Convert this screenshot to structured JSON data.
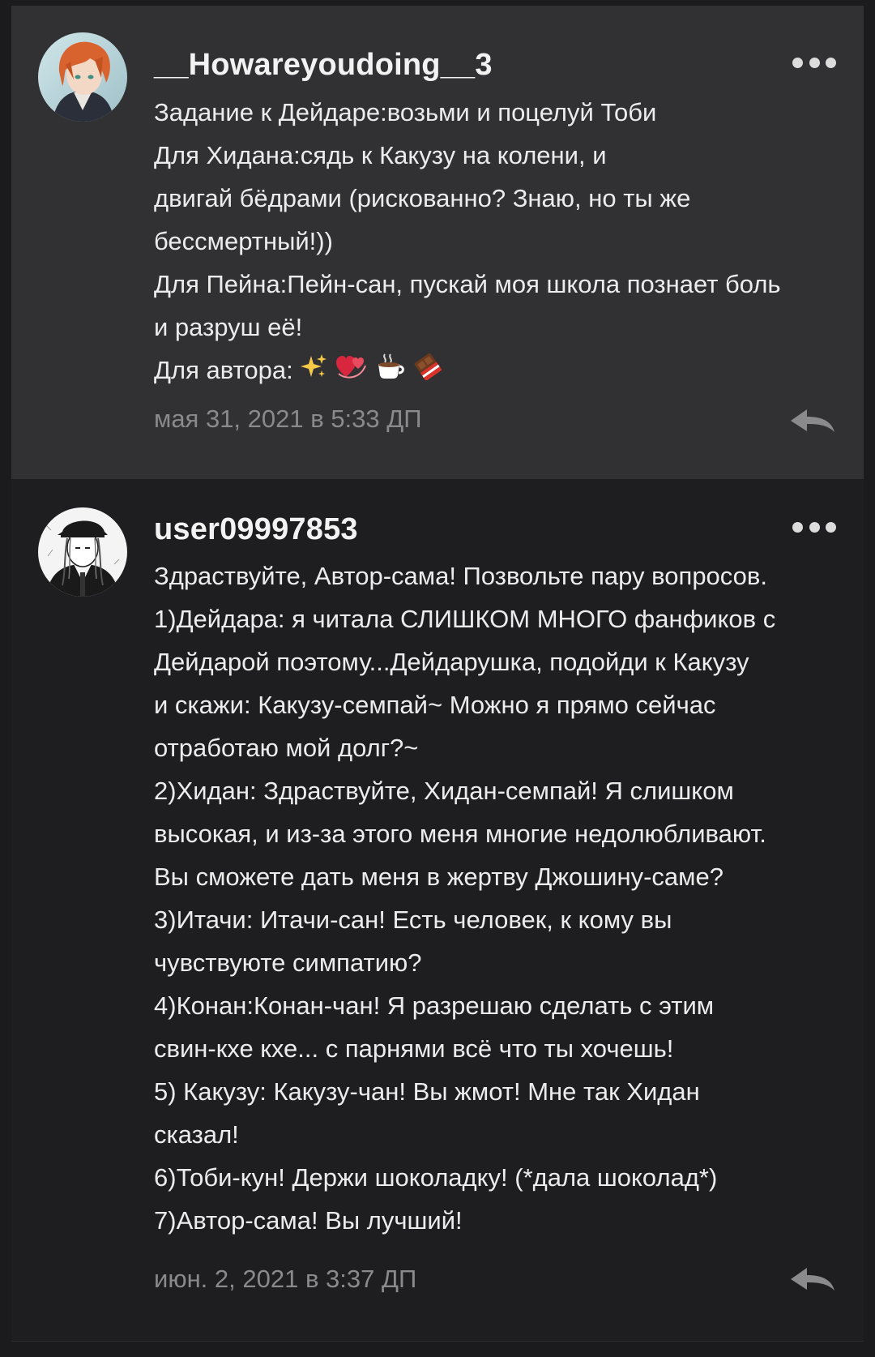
{
  "comments": [
    {
      "username": "__Howareyoudoing__3",
      "lines": [
        "Задание к Дейдаре:возьми и поцелуй Тоби",
        "Для Хидана:сядь к Какузу на колени, и",
        "двигай бёдрами (рискованно? Знаю, но ты же",
        "бессмертный!))",
        "Для Пейна:Пейн-сан, пускай моя школа познает боль",
        "и разруш её!"
      ],
      "last_line_text": "Для автора:",
      "last_line_emojis": [
        "sparkles-emoji",
        "revolving-hearts-emoji",
        "hot-beverage-emoji",
        "chocolate-bar-emoji"
      ],
      "timestamp": "мая 31, 2021 в 5:33 ДП"
    },
    {
      "username": "user09997853",
      "lines": [
        "Здраствуйте, Автор-сама! Позвольте пару вопросов.",
        "1)Дейдара: я читала СЛИШКОМ МНОГО фанфиков с",
        "Дейдарой поэтому...Дейдарушка, подойди к Какузу",
        "и скажи: Какузу-семпай~ Можно я прямо сейчас",
        "отработаю мой долг?~",
        "2)Хидан: Здраствуйте, Хидан-семпай! Я слишком",
        "высокая, и из-за этого меня многие недолюбливают.",
        "Вы сможете дать меня в жертву Джошину-саме?",
        "3)Итачи: Итачи-сан! Есть человек, к кому вы",
        "чувствуюте симпатию?",
        "4)Конан:Конан-чан! Я разрешаю сделать с этим",
        "свин-кхе кхе... с парнями всё что ты хочешь!",
        "5) Какузу: Какузу-чан! Вы жмот! Мне так Хидан",
        "сказал!",
        "6)Тоби-кун! Держи шоколадку! (*дала шоколад*)",
        "7)Автор-сама! Вы лучший!"
      ],
      "timestamp": "июн. 2, 2021 в 3:37 ДП"
    }
  ],
  "icons": {
    "more": "more-dots-icon",
    "reply": "reply-arrow-icon"
  },
  "colors": {
    "page_background": "#1b1b1d",
    "highlighted_comment_background": "#313134",
    "comment_background": "#1e1e20",
    "text": "#ececec",
    "timestamp": "#8a8a8d"
  }
}
